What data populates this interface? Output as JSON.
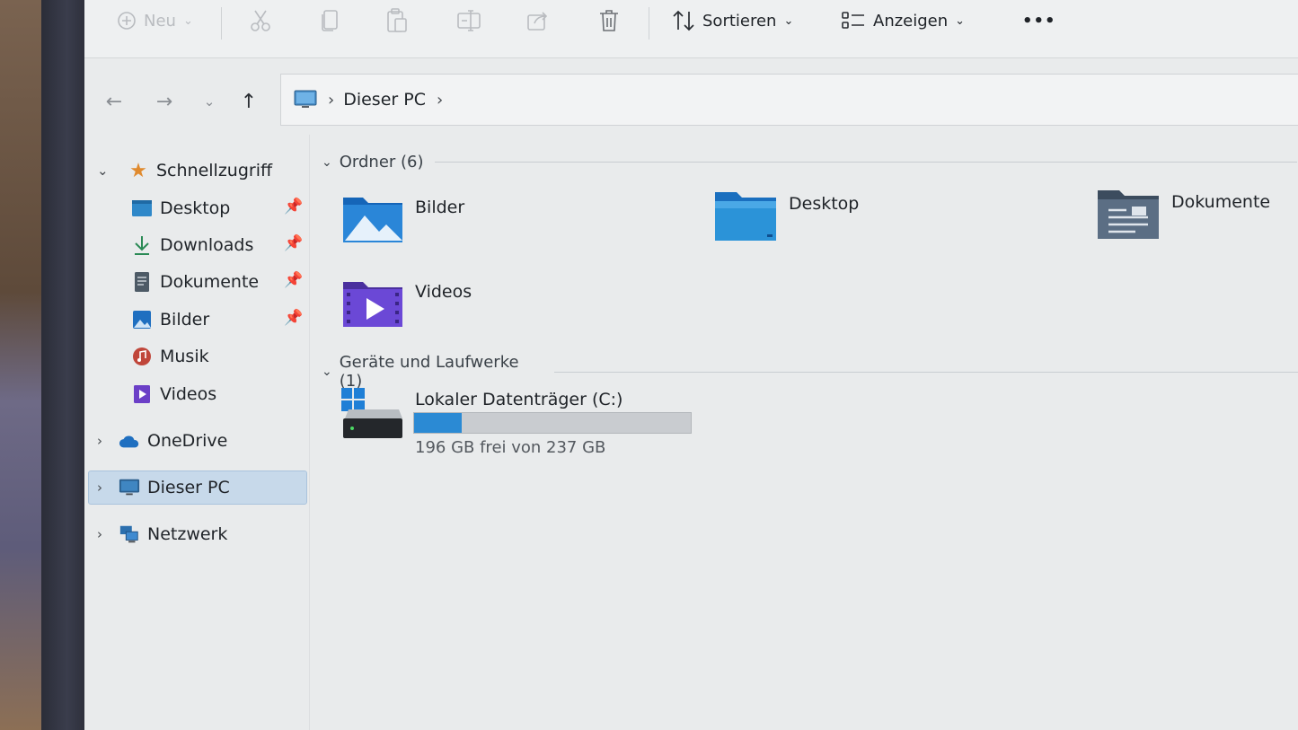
{
  "toolbar": {
    "new_label": "Neu",
    "sort_label": "Sortieren",
    "view_label": "Anzeigen",
    "more_label": "•••"
  },
  "address": {
    "crumb": "Dieser PC",
    "separator": "›"
  },
  "sidebar": {
    "quick_access": "Schnellzugriff",
    "items": [
      {
        "label": "Desktop"
      },
      {
        "label": "Downloads"
      },
      {
        "label": "Dokumente"
      },
      {
        "label": "Bilder"
      },
      {
        "label": "Musik"
      },
      {
        "label": "Videos"
      }
    ],
    "onedrive": "OneDrive",
    "this_pc": "Dieser PC",
    "network": "Netzwerk"
  },
  "content": {
    "folders_header": "Ordner (6)",
    "folders": [
      {
        "label": "Bilder",
        "icon": "pictures-folder-icon"
      },
      {
        "label": "Desktop",
        "icon": "desktop-folder-icon"
      },
      {
        "label": "Dokumente",
        "icon": "documents-folder-icon"
      },
      {
        "label": "Videos",
        "icon": "videos-folder-icon"
      }
    ],
    "drives_header": "Geräte und Laufwerke (1)",
    "drive": {
      "name": "Lokaler Datenträger (C:)",
      "space": "196 GB frei von 237 GB",
      "used_fraction": 0.173
    }
  },
  "colors": {
    "accent": "#2b8ad4",
    "selection": "#c7d9ea"
  }
}
